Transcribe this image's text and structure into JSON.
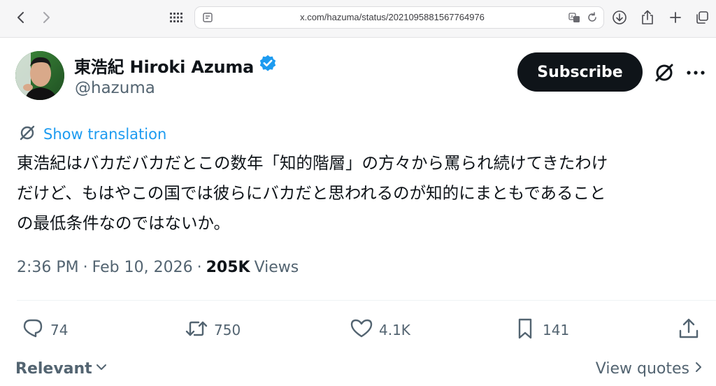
{
  "browser": {
    "url": "x.com/hazuma/status/2021095881567764976",
    "icons": [
      "back-arrow-icon",
      "forward-arrow-icon",
      "grid-icon",
      "page-info-icon",
      "translate-icon",
      "reload-icon",
      "download-icon",
      "share-icon",
      "new-tab-icon",
      "tabs-icon"
    ]
  },
  "tweet": {
    "author": {
      "display_name": "東浩紀 Hiroki Azuma",
      "handle": "@hazuma",
      "verified": true
    },
    "subscribe_label": "Subscribe",
    "show_translation": "Show translation",
    "text_lines": [
      "東浩紀はバカだバカだとこの数年「知的階層」の方々から罵られ続けてきたわけ",
      "だけど、もはやこの国では彼らにバカだと思われるのが知的にまともであること",
      "の最低条件なのではないか。"
    ],
    "meta": {
      "time": "2:36 PM",
      "date": "Feb 10, 2026",
      "separator": "·",
      "views_count": "205K",
      "views_label": "Views"
    },
    "actions": {
      "replies": "74",
      "reposts": "750",
      "likes": "4.1K",
      "bookmarks": "141"
    }
  },
  "footer": {
    "sort_label": "Relevant",
    "view_quotes_label": "View quotes"
  },
  "colors": {
    "link_blue": "#1d9bf0",
    "verified_blue": "#1d9bf0",
    "muted_text": "#536471",
    "primary_text": "#0f1419",
    "button_bg": "#0f1419"
  }
}
